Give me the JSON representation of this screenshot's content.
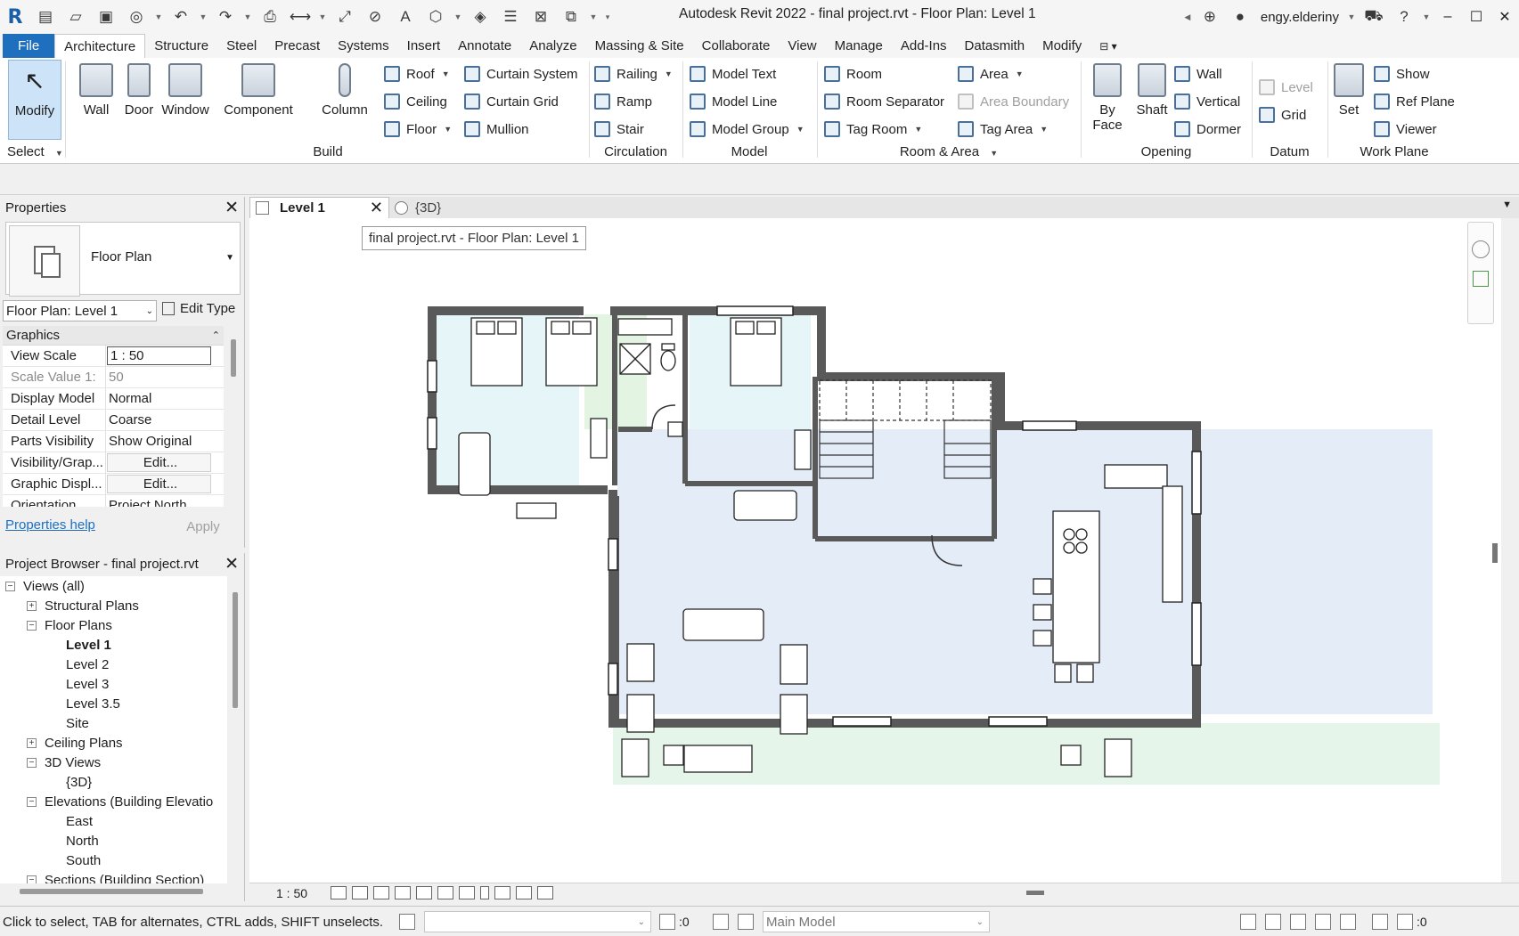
{
  "app": {
    "title": "Autodesk Revit 2022 - final project.rvt - Floor Plan: Level 1",
    "logo": "R",
    "user": "engy.elderiny"
  },
  "ribbon_tabs": [
    "File",
    "Architecture",
    "Structure",
    "Steel",
    "Precast",
    "Systems",
    "Insert",
    "Annotate",
    "Analyze",
    "Massing & Site",
    "Collaborate",
    "View",
    "Manage",
    "Add-Ins",
    "Datasmith",
    "Modify"
  ],
  "active_tab": "Architecture",
  "ribbon": {
    "select": {
      "modify": "Modify",
      "label": "Select"
    },
    "build": {
      "label": "Build",
      "wall": "Wall",
      "door": "Door",
      "window": "Window",
      "component": "Component",
      "column": "Column",
      "roof": "Roof",
      "ceiling": "Ceiling",
      "floor": "Floor",
      "curtain_system": "Curtain System",
      "curtain_grid": "Curtain Grid",
      "mullion": "Mullion"
    },
    "circulation": {
      "label": "Circulation",
      "railing": "Railing",
      "ramp": "Ramp",
      "stair": "Stair"
    },
    "model": {
      "label": "Model",
      "model_text": "Model Text",
      "model_line": "Model Line",
      "model_group": "Model Group"
    },
    "room_area": {
      "label": "Room & Area",
      "room": "Room",
      "room_separator": "Room Separator",
      "tag_room": "Tag Room",
      "area": "Area",
      "area_boundary": "Area Boundary",
      "tag_area": "Tag Area"
    },
    "opening": {
      "label": "Opening",
      "by_face_1": "By",
      "by_face_2": "Face",
      "shaft": "Shaft",
      "wall": "Wall",
      "vertical": "Vertical",
      "dormer": "Dormer"
    },
    "datum": {
      "label": "Datum",
      "level": "Level",
      "grid": "Grid"
    },
    "work_plane": {
      "label": "Work Plane",
      "set": "Set",
      "show": "Show",
      "ref_plane": "Ref Plane",
      "viewer": "Viewer"
    }
  },
  "properties": {
    "title": "Properties",
    "type_name": "Floor Plan",
    "instance": "Floor Plan: Level 1",
    "edit_type": "Edit Type",
    "group": "Graphics",
    "rows": [
      {
        "name": "View Scale",
        "value": "1 : 50"
      },
      {
        "name": "Scale Value    1:",
        "value": "50"
      },
      {
        "name": "Display Model",
        "value": "Normal"
      },
      {
        "name": "Detail Level",
        "value": "Coarse"
      },
      {
        "name": "Parts Visibility",
        "value": "Show Original"
      },
      {
        "name": "Visibility/Grap...",
        "value": "Edit..."
      },
      {
        "name": "Graphic Displ...",
        "value": "Edit..."
      },
      {
        "name": "Orientation",
        "value": "Project North"
      }
    ],
    "help": "Properties help",
    "apply": "Apply"
  },
  "browser": {
    "title": "Project Browser - final project.rvt",
    "nodes": [
      {
        "label": "Views (all)",
        "level": 0,
        "box": "−"
      },
      {
        "label": "Structural Plans",
        "level": 1,
        "box": "+"
      },
      {
        "label": "Floor Plans",
        "level": 1,
        "box": "−"
      },
      {
        "label": "Level 1",
        "level": 2,
        "box": "",
        "bold": true
      },
      {
        "label": "Level 2",
        "level": 2,
        "box": ""
      },
      {
        "label": "Level 3",
        "level": 2,
        "box": ""
      },
      {
        "label": "Level 3.5",
        "level": 2,
        "box": ""
      },
      {
        "label": "Site",
        "level": 2,
        "box": ""
      },
      {
        "label": "Ceiling Plans",
        "level": 1,
        "box": "+"
      },
      {
        "label": "3D Views",
        "level": 1,
        "box": "−"
      },
      {
        "label": "{3D}",
        "level": 2,
        "box": ""
      },
      {
        "label": "Elevations (Building Elevatio",
        "level": 1,
        "box": "−"
      },
      {
        "label": "East",
        "level": 2,
        "box": ""
      },
      {
        "label": "North",
        "level": 2,
        "box": ""
      },
      {
        "label": "South",
        "level": 2,
        "box": ""
      },
      {
        "label": "Sections (Building Section)",
        "level": 1,
        "box": "−"
      }
    ]
  },
  "view_tabs": {
    "active": "Level 1",
    "other": "{3D}"
  },
  "canvas": {
    "tooltip": "final project.rvt - Floor Plan: Level 1"
  },
  "view_control": {
    "scale": "1 : 50"
  },
  "status_bar": {
    "hint": "Click to select, TAB for alternates, CTRL adds, SHIFT unselects.",
    "count": ":0",
    "model": "Main Model",
    "filter": ":0"
  }
}
